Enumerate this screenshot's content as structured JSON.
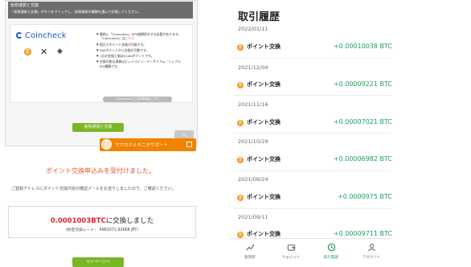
{
  "left": {
    "card_header": "仮想通貨と交換",
    "card_header_sub": "「仮想通貨と交換」ボタンをクリックし、仮想通貨の種類を選んで交換してください。",
    "card_sub": "",
    "brand": "Coincheck",
    "coins": [
      "BTC",
      "XRP",
      "ETH"
    ],
    "bullets": [
      {
        "text": "事前に「Coincheck」の口座開設をする必要があります。「Coincheck」は",
        "link": "こちら"
      },
      {
        "text": "即日でポイント交換が可能です。",
        "link": ""
      },
      {
        "text": "500ポイントから交換が可能です。",
        "link": ""
      },
      {
        "text": "1日の交換上限は5,000ポイントです。",
        "link": ""
      },
      {
        "text": "交換可能な通貨はビットコイン／イーサリアム／リップルの3種類です。",
        "link": ""
      }
    ],
    "note_pill": "Coincheckのご注意事項はこちら",
    "exchange_button": "仮想通貨と交換",
    "collapse_icon": "chevron-down",
    "support_label": "マクロミルモニタサポート",
    "done_title": "ポイント交換申込みを受付けました。",
    "done_desc": "ご登録アドレスにポイント交換内容の確認メールをお送りしましたので、ご確認ください。",
    "result_amount": "0.0001003BTC",
    "result_suffix": "に交換しました",
    "result_rate": "（約定交換レート： 4981071.92668 JPY）",
    "bottom_button": "マイページへ"
  },
  "right": {
    "title": "取引履歴",
    "history": [
      {
        "date": "2022/01/11",
        "label": "ポイント交換",
        "amount": "+0.00010038 BTC"
      },
      {
        "date": "2021/12/04",
        "label": "ポイント交換",
        "amount": "+0.00009221 BTC"
      },
      {
        "date": "2021/11/16",
        "label": "ポイント交換",
        "amount": "+0.00007021 BTC"
      },
      {
        "date": "2021/10/29",
        "label": "ポイント交換",
        "amount": "+0.00006982 BTC"
      },
      {
        "date": "2021/09/24",
        "label": "ポイント交換",
        "amount": "+0.0000975 BTC"
      },
      {
        "date": "2021/09/11",
        "label": "ポイント交換",
        "amount": "+0.00009711 BTC"
      }
    ],
    "tabs": [
      {
        "label": "販売所",
        "icon": "chart-icon"
      },
      {
        "label": "ウォレット",
        "icon": "wallet-icon"
      },
      {
        "label": "取引履歴",
        "icon": "history-icon"
      },
      {
        "label": "アカウント",
        "icon": "account-icon"
      }
    ],
    "active_tab": "取引履歴"
  },
  "colors": {
    "accent_orange": "#e8552a",
    "btc_orange": "#f29a1f",
    "positive_green": "#1aa05d",
    "button_green": "#7ab526",
    "error_red": "#e0262c"
  }
}
